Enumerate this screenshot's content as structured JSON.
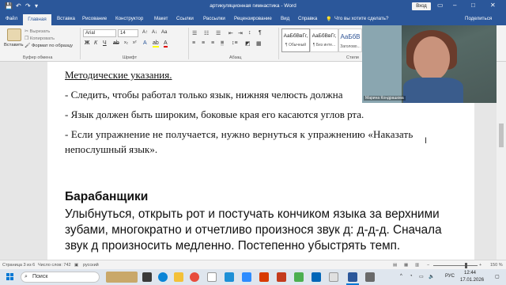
{
  "window": {
    "title": "артикуляционная гимнастика - Word",
    "signin": "Вход",
    "minimize_icon": "minimize-icon",
    "restore_icon": "restore-icon",
    "close_icon": "close-icon"
  },
  "tabs": {
    "file": "Файл",
    "home": "Главная",
    "insert": "Вставка",
    "draw": "Рисование",
    "design": "Конструктор",
    "layout": "Макет",
    "references": "Ссылки",
    "mailings": "Рассылки",
    "review": "Рецензирование",
    "view": "Вид",
    "help": "Справка",
    "tellme": "Что вы хотите сделать?",
    "share": "Поделиться"
  },
  "ribbon": {
    "paste": "Вставить",
    "cut": "Вырезать",
    "copy": "Копировать",
    "format_painter": "Формат по образцу",
    "clipboard_label": "Буфер обмена",
    "font_name": "Arial",
    "font_size": "14",
    "font_label": "Шрифт",
    "paragraph_label": "Абзац",
    "styles_label": "Стили",
    "styles": [
      {
        "sample": "АаБбВвГг,",
        "name": "¶ Обычный"
      },
      {
        "sample": "АаБбВвГг,",
        "name": "¶ Без инте..."
      },
      {
        "sample": "АаБбВ",
        "name": "Заголово..."
      }
    ]
  },
  "document": {
    "heading_methodical": "Методические указания.",
    "line1": "- Следить, чтобы работал только язык, нижняя челюсть должна",
    "line2": "- Язык должен быть широким, боковые края его касаются углов рта.",
    "line3a": "- Если упражнение не получается, нужно вернуться к упражнению «Наказать",
    "line3b": "непослушный язык».",
    "section_title": "Барабанщики",
    "para1": "Улыбнуться, открыть рот и постучать кончиком языка за верхними",
    "para2": "зубами, многократно и отчетливо произнося звук д: д-д-д. Сначала",
    "para3": "звук д произносить медленно. Постепенно убыстрять темп."
  },
  "webcam": {
    "name": "Марина Кондрашова"
  },
  "statusbar": {
    "page": "Страница 3 из 6",
    "words": "Число слов: 742",
    "language": "русский",
    "zoom": "150 %"
  },
  "taskbar": {
    "search": "Поиск",
    "language": "РУС",
    "time": "12:44",
    "date": "17.01.2026"
  },
  "colors": {
    "word_blue": "#2b579a"
  }
}
